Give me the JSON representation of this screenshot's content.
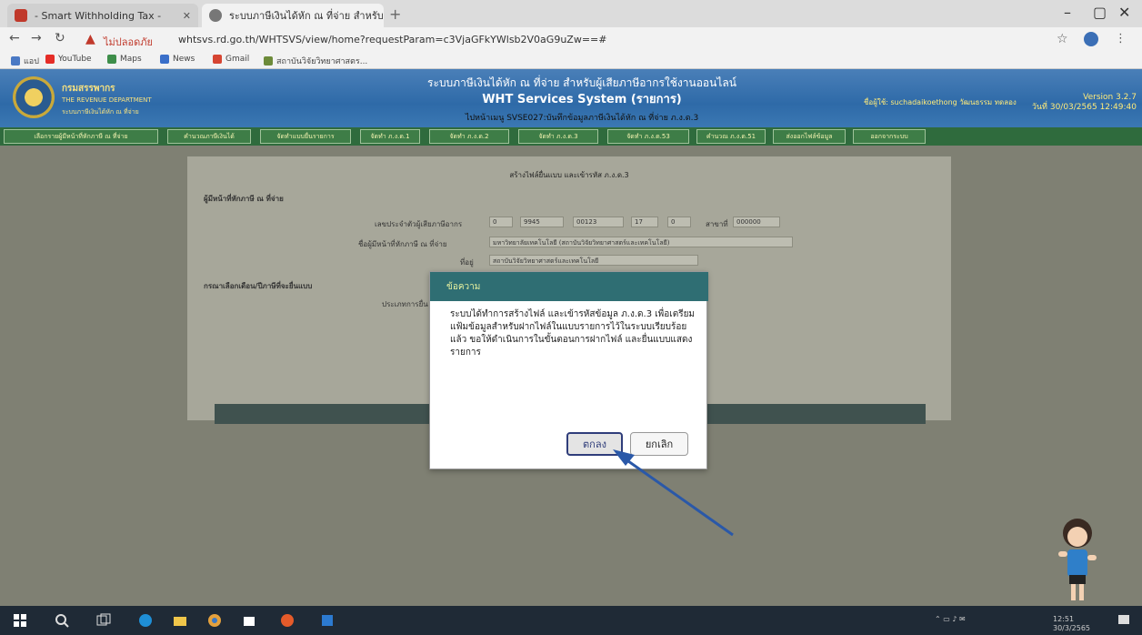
{
  "browser": {
    "tabs": [
      {
        "label": "- Smart Withholding Tax -",
        "state": "inactive"
      },
      {
        "label": "ระบบภาษีเงินได้หัก ณ ที่จ่าย สำหรับผู้...",
        "state": "active"
      }
    ],
    "insecure_label": "ไม่ปลอดภัย",
    "url": "whtsvs.rd.go.th/WHTSVS/view/home?requestParam=c3VjaGFkYWlsb2V0aG9uZw==#",
    "bookmarks": [
      "แอป",
      "YouTube",
      "Maps",
      "News",
      "Gmail",
      "สถาบันวิจัยวิทยาศาสตร..."
    ]
  },
  "header": {
    "org_name": "กรมสรรพากร",
    "org_en": "THE REVENUE DEPARTMENT",
    "org_sub": "ระบบภาษีเงินได้หัก ณ ที่จ่าย",
    "title_th": "ระบบภาษีเงินได้หัก ณ ที่จ่าย สำหรับผู้เสียภาษีอากรใช้งานออนไลน์",
    "title_en": "WHT Services System (รายการ)",
    "menu_code": "ไปหน้าเมนู SVSE027:บันทึกข้อมูลภาษีเงินได้หัก ณ ที่จ่าย ภ.ง.ด.3",
    "user_label": "ชื่อผู้ใช้: suchadaikoethong วัฒนธรรม ทดลอง",
    "version": "Version 3.2.7",
    "date_line": "วันที่ 30/03/2565 12:49:40"
  },
  "menu": [
    "เลือกรายผู้มีหน้าที่หักภาษี ณ ที่จ่าย",
    "คำนวณภาษีเงินได้",
    "จัดทำแบบยื่นรายการ",
    "จัดทำ ภ.ง.ด.1",
    "จัดทำ ภ.ง.ด.2",
    "จัดทำ ภ.ง.ด.3",
    "จัดทำ ภ.ง.ด.53",
    "คำนวณ ภ.ง.ด.51",
    "ส่งออกไฟล์ข้อมูล",
    "ออกจากระบบ"
  ],
  "panel": {
    "title": "สร้างไฟล์ยื่นแบบ และเข้ารหัส ภ.ง.ด.3",
    "section1": "ผู้มีหน้าที่หักภาษี ณ ที่จ่าย",
    "tax_id_label": "เลขประจำตัวผู้เสียภาษีอากร",
    "tax_id_parts": [
      "0",
      "9945",
      "00123",
      "17",
      "0"
    ],
    "branch_label": "สาขาที่",
    "branch_value": "000000",
    "name_label": "ชื่อผู้มีหน้าที่หักภาษี ณ ที่จ่าย",
    "name_value": "มหาวิทยาลัยเทคโนโลยี (สถาบันวิจัยวิทยาศาสตร์และเทคโนโลยี)",
    "address_label": "ที่อยู่",
    "address_value": "สถาบันวิจัยวิทยาศาสตร์และเทคโนโลยี",
    "section2": "กรณาเลือกเดือน/ปีภาษีที่จะยื่นแบบ",
    "section2_label": "ประเภทการยื่น"
  },
  "dialog": {
    "title": "ข้อความ",
    "message": "ระบบได้ทำการสร้างไฟล์ และเข้ารหัสข้อมูล ภ.ง.ด.3 เพื่อเตรียมแฟ้มข้อมูลสำหรับฝากไฟล์ในแบบรายการไว้ในระบบเรียบร้อยแล้ว ขอให้ดำเนินการในขั้นตอนการฝากไฟล์ และยื่นแบบแสดงรายการ",
    "ok_label": "ตกลง",
    "cancel_label": "ยกเลิก"
  },
  "taskbar": {
    "time": "12:51",
    "date": "30/3/2565"
  },
  "colors": {
    "header_blue": "#2e6aa8",
    "menu_green": "#3e7d47",
    "dialog_teal": "#2f6e73",
    "arrow_blue": "#2a58a8"
  }
}
